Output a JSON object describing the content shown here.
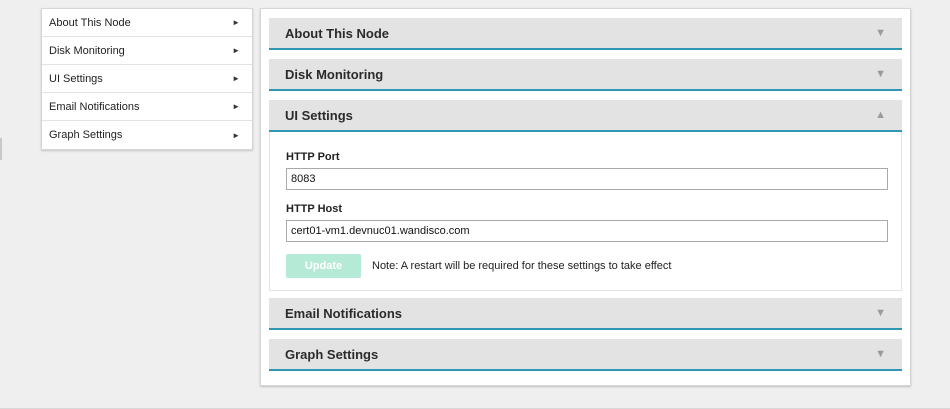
{
  "sidebar": {
    "items": [
      {
        "label": "About This Node"
      },
      {
        "label": "Disk Monitoring"
      },
      {
        "label": "UI Settings"
      },
      {
        "label": "Email Notifications"
      },
      {
        "label": "Graph Settings"
      }
    ],
    "arrow_glyph": "►"
  },
  "accordion": {
    "sections": [
      {
        "title": "About This Node",
        "state": "collapsed"
      },
      {
        "title": "Disk Monitoring",
        "state": "collapsed"
      },
      {
        "title": "UI Settings",
        "state": "expanded"
      },
      {
        "title": "Email Notifications",
        "state": "collapsed"
      },
      {
        "title": "Graph Settings",
        "state": "collapsed"
      }
    ],
    "collapsed_glyph": "▼",
    "expanded_glyph": "▲"
  },
  "ui_settings": {
    "http_port_label": "HTTP Port",
    "http_port_value": "8083",
    "http_host_label": "HTTP Host",
    "http_host_value": "cert01-vm1.devnuc01.wandisco.com",
    "update_label": "Update",
    "note": "Note: A restart will be required for these settings to take effect"
  },
  "colors": {
    "accent_border": "#2f97b4",
    "update_button_disabled": "#b5ead6",
    "header_background": "#e3e3e3"
  }
}
